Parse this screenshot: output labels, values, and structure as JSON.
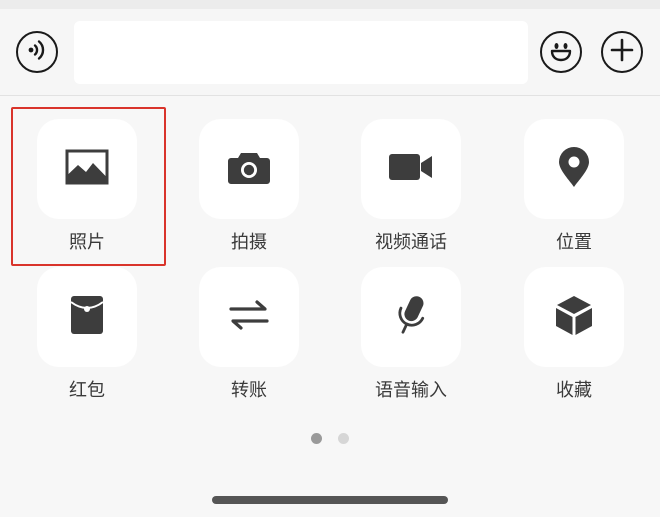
{
  "composer": {
    "input_value": "",
    "input_placeholder": ""
  },
  "panel": {
    "items": [
      {
        "label": "照片",
        "icon": "photo-icon"
      },
      {
        "label": "拍摄",
        "icon": "camera-icon"
      },
      {
        "label": "视频通话",
        "icon": "video-call-icon"
      },
      {
        "label": "位置",
        "icon": "location-pin-icon"
      },
      {
        "label": "红包",
        "icon": "red-packet-icon"
      },
      {
        "label": "转账",
        "icon": "transfer-icon"
      },
      {
        "label": "语音输入",
        "icon": "microphone-icon"
      },
      {
        "label": "收藏",
        "icon": "favorites-cube-icon"
      }
    ],
    "selected_index": 0,
    "highlight_color": "#d9342b",
    "icon_color": "#3d3d3d"
  },
  "pager": {
    "page_count": 2,
    "current_page": 1,
    "active_color": "#9a9a9a",
    "inactive_color": "#d6d6d6"
  }
}
